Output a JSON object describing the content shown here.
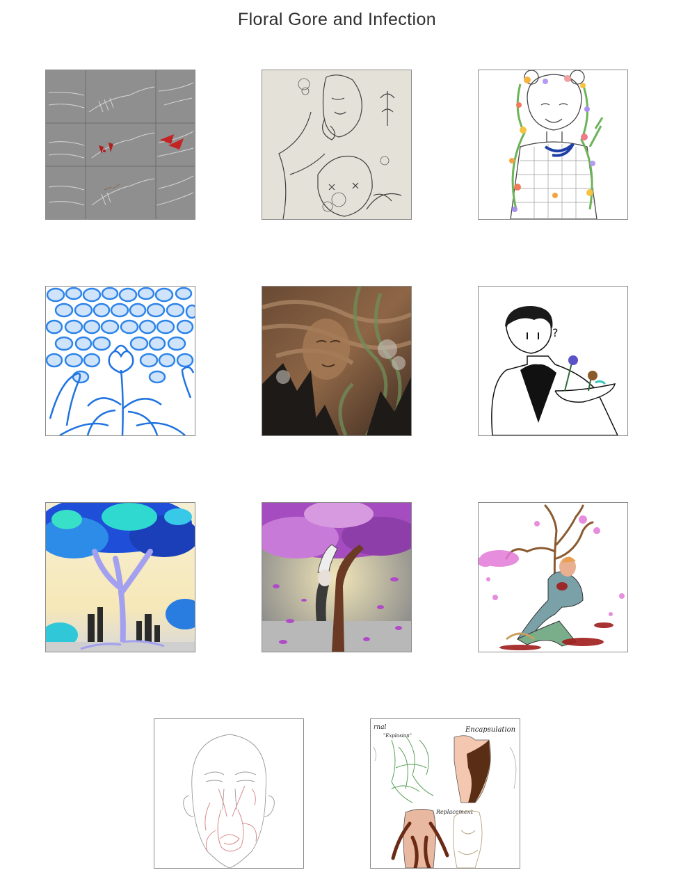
{
  "gallery": {
    "title": "Floral Gore and Infection",
    "items": [
      {
        "art": "hand-infection-study-grid",
        "texts": []
      },
      {
        "art": "floral-faces-pencil-sketch",
        "texts": []
      },
      {
        "art": "girl-with-flower-vines",
        "texts": []
      },
      {
        "art": "blue-cell-flower-hands",
        "texts": []
      },
      {
        "art": "smoke-face-painting",
        "texts": []
      },
      {
        "art": "man-holding-roses",
        "texts": [
          "?"
        ]
      },
      {
        "art": "blue-tree-forest",
        "texts": []
      },
      {
        "art": "purple-tree-hanging-figure",
        "texts": []
      },
      {
        "art": "tree-growing-from-body",
        "texts": []
      },
      {
        "art": "face-line-sketch",
        "texts": []
      },
      {
        "art": "torso-studies",
        "texts": [
          "rnal",
          "\"Explosion\"",
          "Encapsulation",
          "Replacement"
        ]
      }
    ]
  }
}
